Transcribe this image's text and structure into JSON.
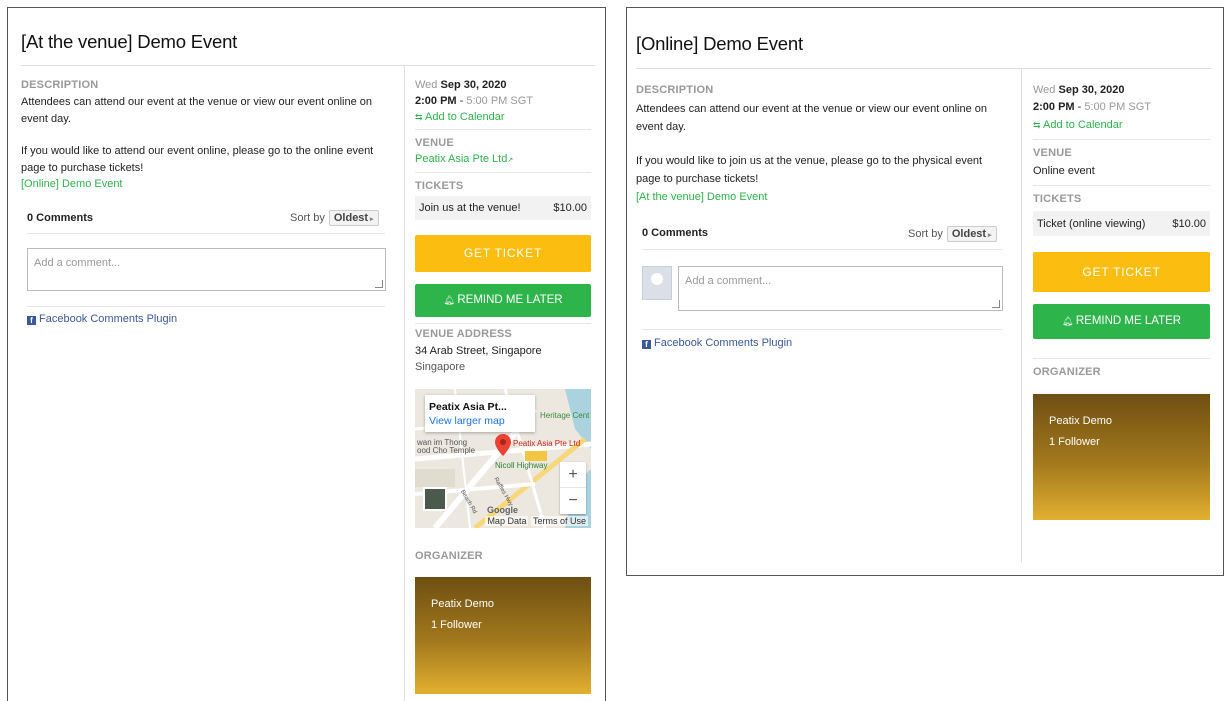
{
  "left": {
    "title": "[At the venue] Demo Event",
    "description_label": "DESCRIPTION",
    "description_p1_l1": "Attendees can attend our event at the venue or view our event online on",
    "description_p1_l2": "event day.",
    "description_p2_l1": "If you would like to attend our event online, please go to the online event",
    "description_p2_l2": "page to purchase tickets!",
    "cross_link": "[Online] Demo Event",
    "comments_count": "0 Comments",
    "sort_by": "Sort by",
    "sort_value": "Oldest",
    "comment_placeholder": "Add a comment...",
    "fb_plugin": "Facebook Comments Plugin",
    "date_day": "Wed",
    "date": "Sep 30, 2020",
    "time_start": "2:00 PM",
    "time_sep": " - ",
    "time_end": "5:00 PM SGT",
    "add_to_calendar": "Add to Calendar",
    "venue_label": "VENUE",
    "venue_name": "Peatix Asia Pte Ltd",
    "tickets_label": "TICKETS",
    "ticket_name": "Join us at the venue!",
    "ticket_price": "$10.00",
    "get_ticket": "GET TICKET",
    "remind_me": "REMIND ME LATER",
    "venue_address_label": "VENUE ADDRESS",
    "address_line1": "34 Arab Street, Singapore",
    "address_line2": "Singapore",
    "map": {
      "popup_title": "Peatix Asia Pt...",
      "popup_link": "View larger map",
      "marker_label": "Peatix Asia Pte Ltd",
      "label_heritage": "Heritage Cent",
      "label_temple_1": "wan im Thong",
      "label_temple_2": "ood Cho Temple",
      "label_nicoll": "Nicoll Highway",
      "label_road": "Beach Rd",
      "label_hwy": "Raffles Hwy",
      "zoom_in": "+",
      "zoom_out": "−",
      "google": "Google",
      "map_data": "Map Data",
      "terms": "Terms of Use"
    },
    "organizer_label": "ORGANIZER",
    "organizer_name": "Peatix Demo",
    "organizer_followers": "1 Follower"
  },
  "right": {
    "title": "[Online] Demo Event",
    "description_label": "DESCRIPTION",
    "description_p1_l1": "Attendees can attend our event at the venue or view our event online on",
    "description_p1_l2": "event day.",
    "description_p2_l1": "If you would like to join us at the venue, please go to the physical event",
    "description_p2_l2": "page to purchase tickets!",
    "cross_link": "[At the venue] Demo Event",
    "comments_count": "0 Comments",
    "sort_by": "Sort by",
    "sort_value": "Oldest",
    "comment_placeholder": "Add a comment...",
    "fb_plugin": "Facebook Comments Plugin",
    "date_day": "Wed",
    "date": "Sep 30, 2020",
    "time_start": "2:00 PM",
    "time_sep": " - ",
    "time_end": "5:00 PM SGT",
    "add_to_calendar": "Add to Calendar",
    "venue_label": "VENUE",
    "venue_name": "Online event",
    "tickets_label": "TICKETS",
    "ticket_name": "Ticket (online viewing)",
    "ticket_price": "$10.00",
    "get_ticket": "GET TICKET",
    "remind_me": "REMIND ME LATER",
    "organizer_label": "ORGANIZER",
    "organizer_name": "Peatix Demo",
    "organizer_followers": "1 Follower"
  },
  "colors": {
    "accent_green": "#2fb14a",
    "get_ticket_yellow": "#fbbd10",
    "remind_green": "#2db54b",
    "facebook_blue": "#3b5998",
    "label_grey": "#999999"
  },
  "icons": {
    "calendar": "calendar-add-icon",
    "external": "external-link-icon",
    "bell": "bell-icon",
    "facebook": "facebook-icon",
    "marker": "map-marker-icon"
  }
}
